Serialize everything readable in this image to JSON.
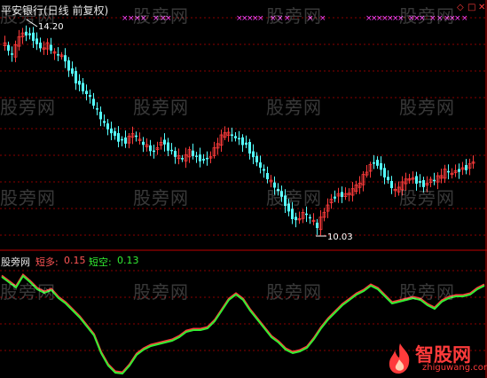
{
  "header": {
    "title": "平安银行(日线 前复权)",
    "icons": [
      "diamond-icon",
      "square-icon",
      "close-icon"
    ]
  },
  "main_chart": {
    "type": "candlestick",
    "high_label": "14.20",
    "low_label": "10.03",
    "up_color": "#ff3b3b",
    "down_color": "#54ffff",
    "signal_color": "#ff44ff",
    "grid": "dotted red lines"
  },
  "sub_chart": {
    "name": "股旁网",
    "short_long_label": "短多:",
    "short_long_value": "0.15",
    "short_empty_label": "短空:",
    "short_empty_value": "0.13",
    "short_long_color": "#ff3b3b",
    "short_empty_color": "#33ee33"
  },
  "watermark": "股旁网",
  "brand": {
    "name": "智股网",
    "url": "zhiguwang.com"
  }
}
